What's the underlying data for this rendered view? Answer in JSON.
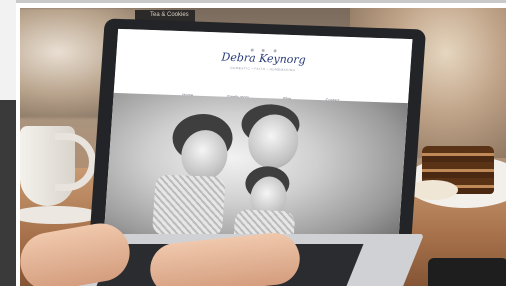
{
  "image": {
    "description_label": "Laptop on cafe table showing a blog website"
  },
  "website": {
    "title": "Debra Keynorg",
    "subtitle": "DOMESTIC • FAITH • HOMEMAKING",
    "nav": [
      "Home",
      "Family story",
      "Blog",
      "Contact"
    ]
  },
  "background_sign": "Tea & Cookies"
}
